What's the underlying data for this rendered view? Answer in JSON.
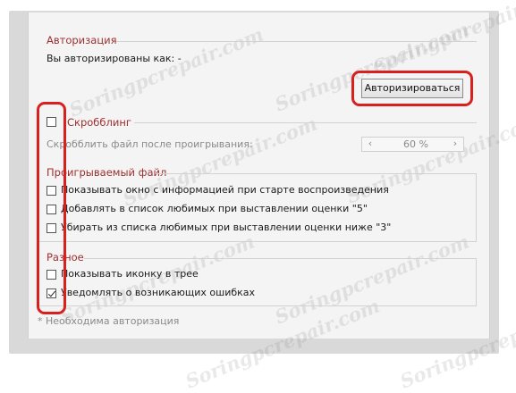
{
  "authorization": {
    "header": "Авторизация",
    "status_text": "Вы авторизированы как: -",
    "button_label": "Авторизироваться"
  },
  "scrobbling": {
    "header": "Скробблинг",
    "checked": false,
    "after_play_label": "Скробблить файл после проигрывания:",
    "percent_value": "60 %"
  },
  "playing_file": {
    "header": "Проигрываемый файл",
    "options": [
      {
        "label": "Показывать окно с информацией при старте воспроизведения",
        "checked": false
      },
      {
        "label": "Добавлять в список любимых при выставлении оценки \"5\"",
        "checked": false
      },
      {
        "label": "Убирать из списка любимых при выставлении оценки ниже \"3\"",
        "checked": false
      }
    ]
  },
  "misc": {
    "header": "Разное",
    "options": [
      {
        "label": "Показывать иконку в трее",
        "checked": false
      },
      {
        "label": "Уведомлять о возникающих ошибках",
        "checked": true
      }
    ]
  },
  "footnote": "* Необходима авторизация",
  "watermark": "Soringpcrepair.com",
  "colors": {
    "section_header": "#9e2e2e",
    "highlight_ring": "#d8201e"
  }
}
